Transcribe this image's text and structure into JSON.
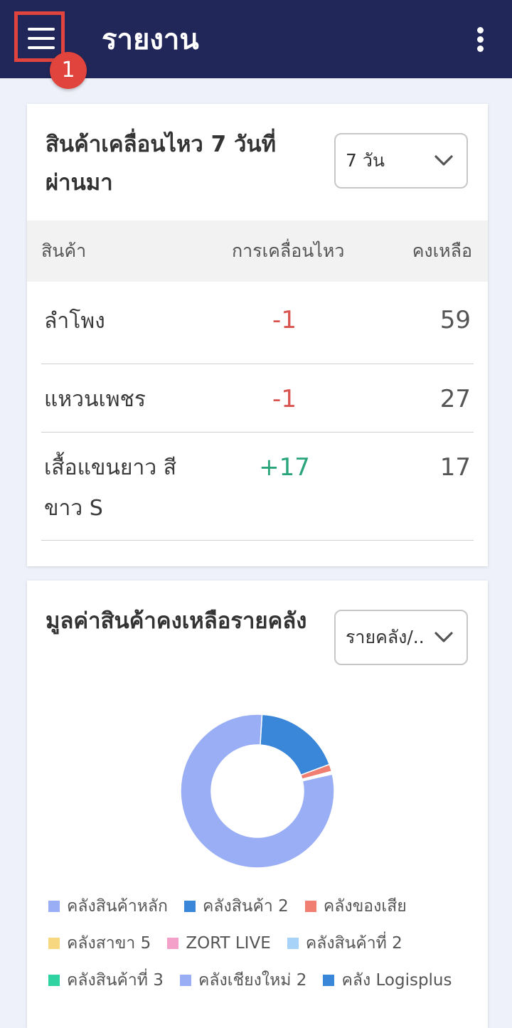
{
  "appbar": {
    "title": "รายงาน",
    "step_badge": "1",
    "menu_icon": "hamburger-menu-icon",
    "more_icon": "more-vertical-icon",
    "colors": {
      "background": "#22275a",
      "highlight": "#e0443d"
    }
  },
  "movement_card": {
    "title": "สินค้าเคลื่อนไหว 7 วันที่ผ่านมา",
    "period_select": {
      "value": "7 วัน",
      "icon": "chevron-down-icon"
    },
    "headers": {
      "product": "สินค้า",
      "movement": "การเคลื่อนไหว",
      "remaining": "คงเหลือ"
    },
    "rows": [
      {
        "name": "ลำโพง",
        "movement": "-1",
        "remaining": "59"
      },
      {
        "name": "แหวนเพชร",
        "movement": "-1",
        "remaining": "27"
      },
      {
        "name": "เสื้อแขนยาว สีขาว S",
        "movement": "+17",
        "remaining": "17"
      }
    ],
    "colors": {
      "negative": "#d9534f",
      "positive": "#2aa57a"
    }
  },
  "value_card": {
    "title": "มูลค่าสินค้าคงเหลือรายคลัง",
    "view_select": {
      "value": "รายคลัง/..",
      "icon": "chevron-down-icon"
    },
    "legend": [
      [
        {
          "label": "คลังสินค้าหลัก",
          "color": "#9aaef5"
        },
        {
          "label": "คลังสินค้า 2",
          "color": "#3a86d8"
        },
        {
          "label": "คลังของเสีย",
          "color": "#f07f72"
        }
      ],
      [
        {
          "label": "คลังสาขา 5",
          "color": "#f7d880"
        },
        {
          "label": "ZORT LIVE",
          "color": "#f3a1c8"
        },
        {
          "label": "คลังสินค้าที่ 2",
          "color": "#a6d3f7"
        }
      ],
      [
        {
          "label": "คลังสินค้าที่ 3",
          "color": "#2fd3a2"
        },
        {
          "label": "คลังเชียงใหม่ 2",
          "color": "#9aaef5"
        },
        {
          "label": "คลัง Logisplus",
          "color": "#3a86d8"
        }
      ]
    ]
  },
  "chart_data": {
    "type": "pie",
    "donut": true,
    "categories": [
      "คลังสินค้าหลัก",
      "คลังสินค้า 2",
      "คลังของเสีย",
      "คลังสาขา 5",
      "ZORT LIVE",
      "คลังสินค้าที่ 2",
      "คลังสินค้าที่ 3",
      "คลังเชียงใหม่ 2",
      "คลัง Logisplus"
    ],
    "values": [
      79.5,
      18.4,
      1.5,
      0.1,
      0.1,
      0.1,
      0.1,
      0.1,
      0.1
    ],
    "colors": [
      "#9aaef5",
      "#3a86d8",
      "#f07f72",
      "#f7d880",
      "#f3a1c8",
      "#a6d3f7",
      "#2fd3a2",
      "#9aaef5",
      "#3a86d8"
    ],
    "legend_position": "bottom"
  }
}
